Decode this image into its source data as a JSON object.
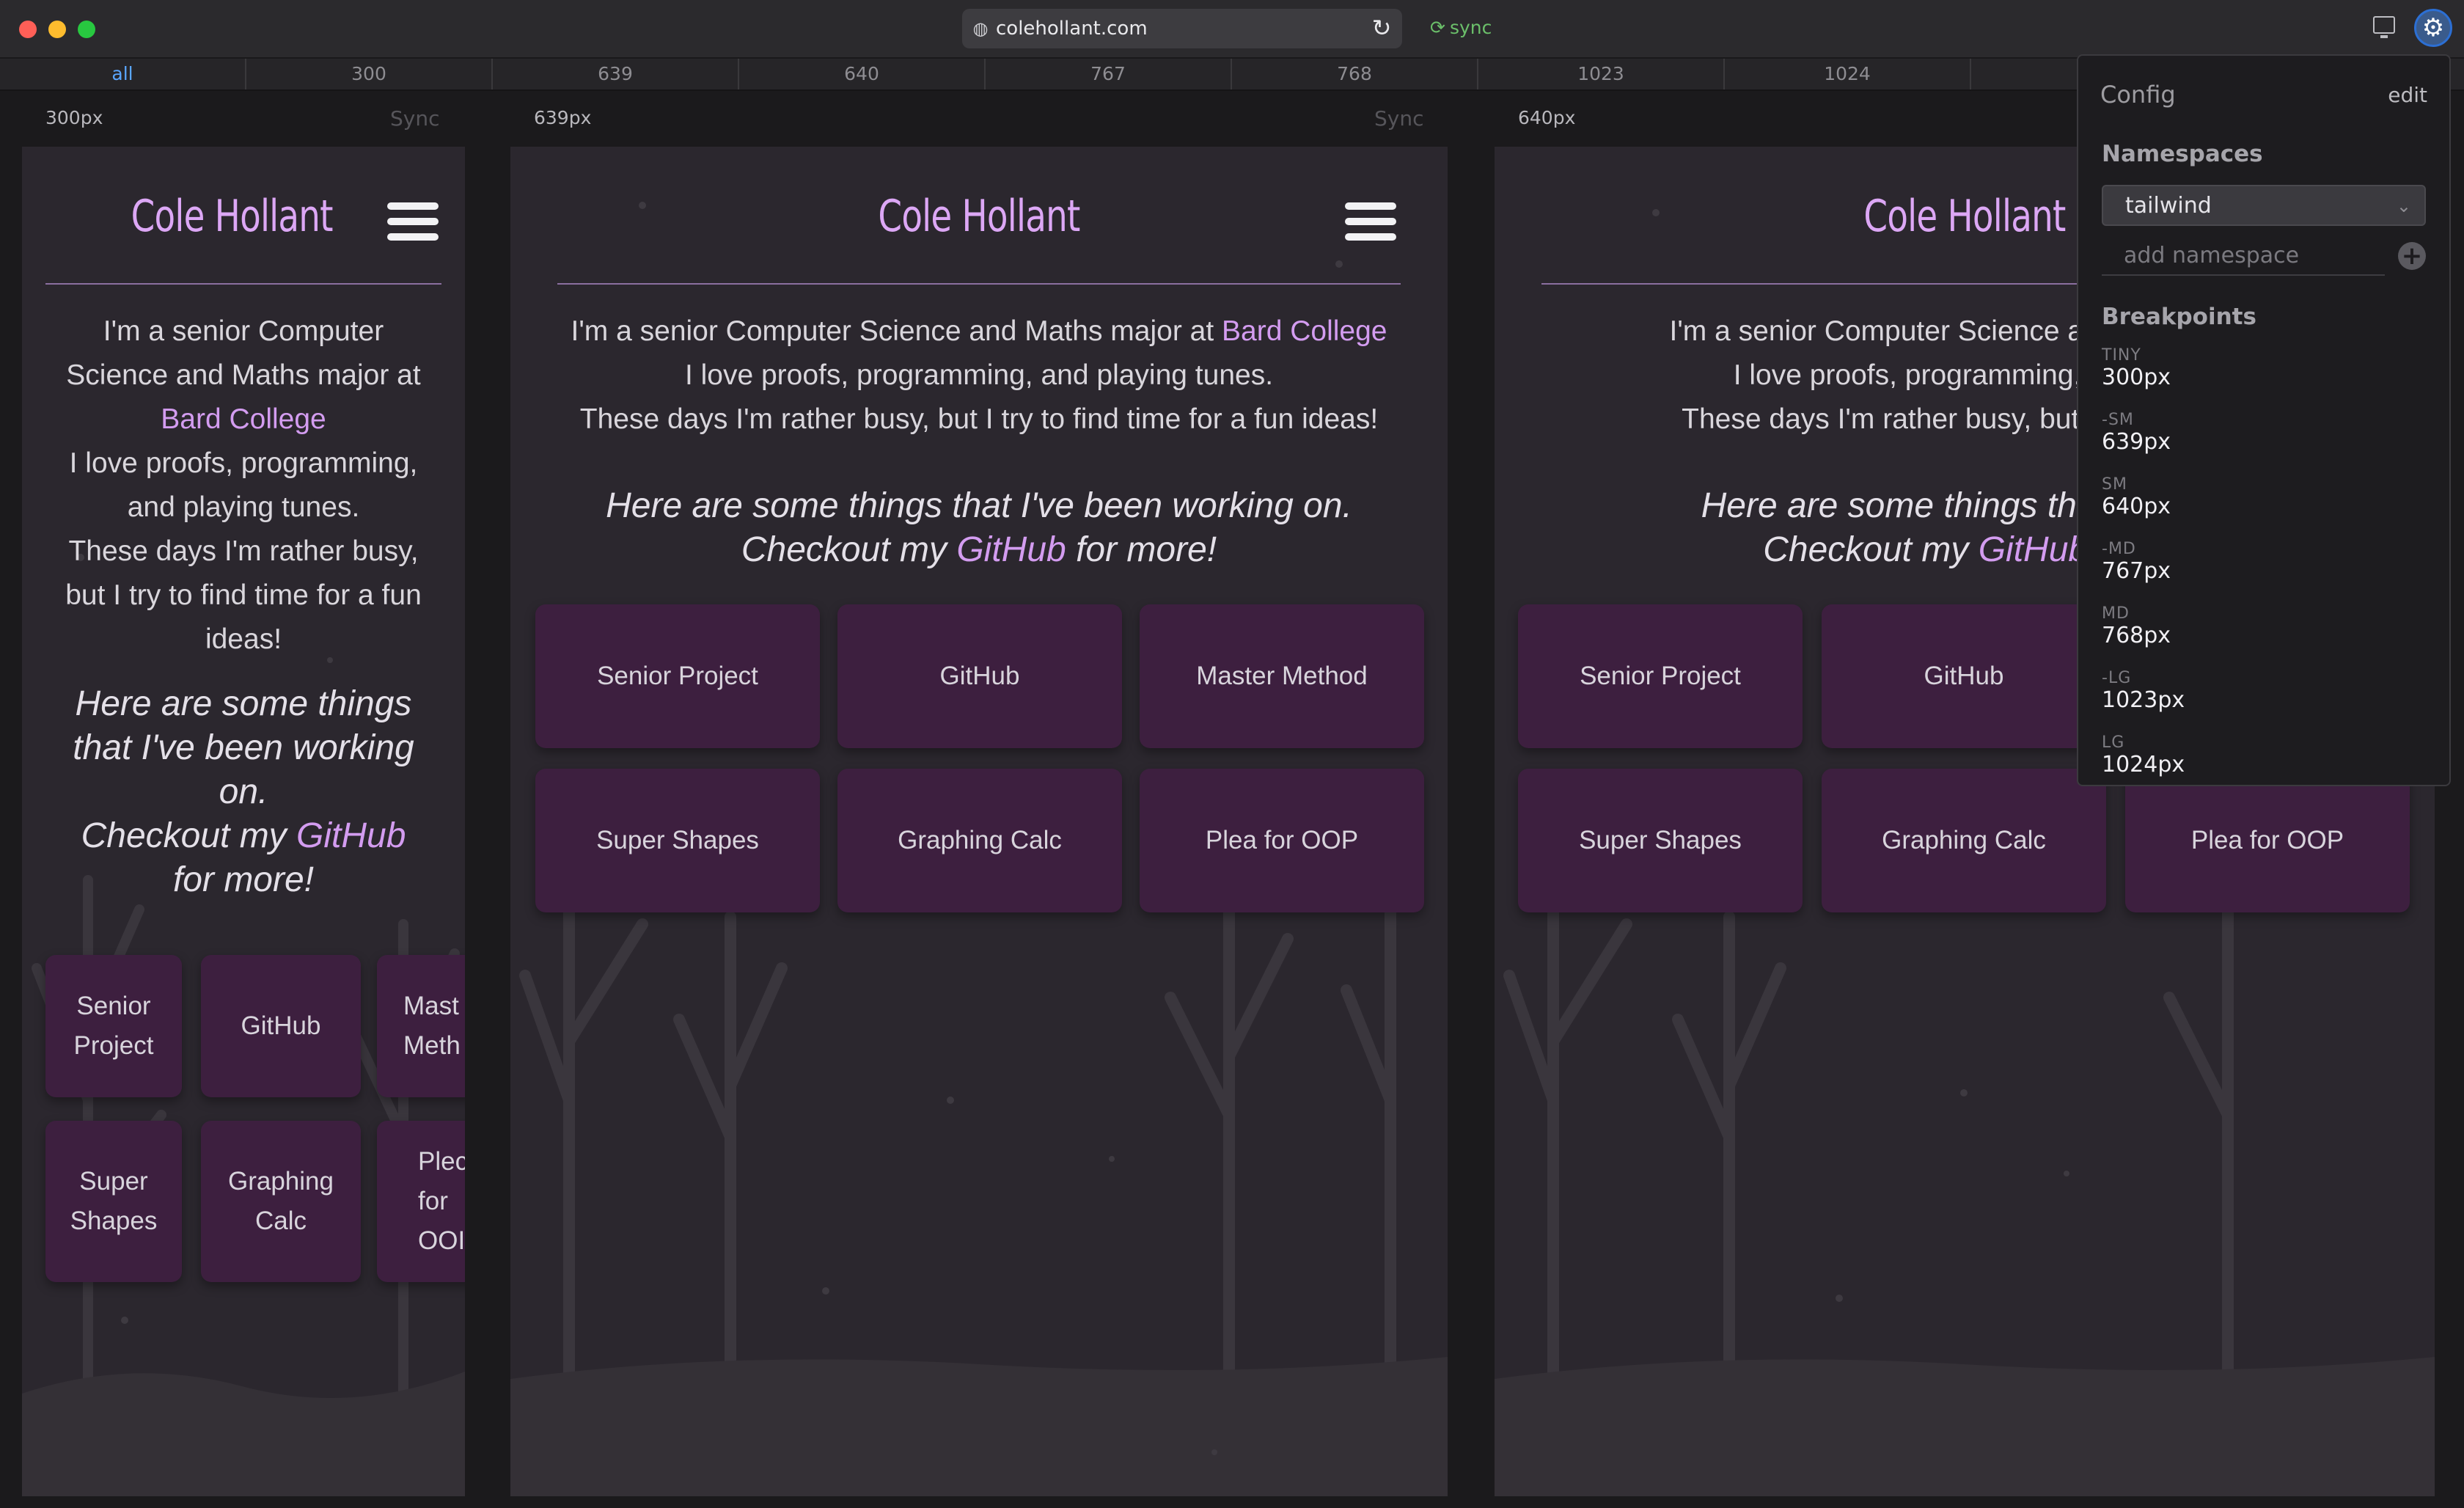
{
  "toolbar": {
    "url": "colehollant.com",
    "sync_label": "sync"
  },
  "ruler": {
    "tabs": [
      "all",
      "300",
      "639",
      "640",
      "767",
      "768",
      "1023",
      "1024"
    ]
  },
  "frames": [
    {
      "label": "300px",
      "sync": "Sync"
    },
    {
      "label": "639px",
      "sync": "Sync"
    },
    {
      "label": "640px"
    }
  ],
  "site": {
    "name": "Cole Hollant",
    "intro_1": "I'm a senior Computer Science and Maths major at",
    "college": "Bard College",
    "intro_2": "I love proofs, programming, and playing tunes.",
    "intro_3": "These days I'm rather busy, but I try to find time for a fun ideas!",
    "tagline_1": "Here are some things that I've been working on.",
    "tagline_2a": "Checkout my",
    "github_link": "GitHub",
    "tagline_2b": "for more!",
    "projects": [
      "Senior Project",
      "GitHub",
      "Master Method",
      "Super Shapes",
      "Graphing Calc",
      "Plea for OOP"
    ]
  },
  "narrow": {
    "intro_lines": [
      "I'm a senior Computer",
      "Science and Maths major at"
    ],
    "intro_rest": [
      "I love proofs, programming,",
      "and playing tunes.",
      "These days I'm rather busy,",
      "but I try to find time for a fun",
      "ideas!"
    ],
    "tagline_lines": [
      "Here are some things",
      "that I've been working",
      "on."
    ],
    "checkout": "Checkout my",
    "for_more": "for more!",
    "cards": [
      [
        "Senior",
        "Project"
      ],
      [
        "GitHub"
      ],
      [
        "Mast",
        "Meth"
      ],
      [
        "Super",
        "Shapes"
      ],
      [
        "Graphing",
        "Calc"
      ],
      [
        "Plec",
        "for",
        "OOI"
      ]
    ]
  },
  "partial": {
    "intro_1": "I'm a senior Computer Science and Maths",
    "intro_2": "I love proofs, programming, and",
    "intro_3": "These days I'm rather busy, but I try to fi",
    "tagline_1": "Here are some things that I've",
    "tagline_2a": "Checkout my",
    "github_link": "GitHub",
    "tagline_2b": "f"
  },
  "config": {
    "title": "Config",
    "edit_label": "edit",
    "namespaces_heading": "Namespaces",
    "namespace_selected": "tailwind",
    "add_namespace_placeholder": "add namespace",
    "breakpoints_heading": "Breakpoints",
    "breakpoints": [
      {
        "name": "TINY",
        "value": "300px"
      },
      {
        "name": "-SM",
        "value": "639px"
      },
      {
        "name": "SM",
        "value": "640px"
      },
      {
        "name": "-MD",
        "value": "767px"
      },
      {
        "name": "MD",
        "value": "768px"
      },
      {
        "name": "-LG",
        "value": "1023px"
      },
      {
        "name": "LG",
        "value": "1024px"
      }
    ]
  },
  "colors": {
    "accent": "#d39cf0",
    "card": "#3d1f3f",
    "site_bg": "#2b272e"
  }
}
